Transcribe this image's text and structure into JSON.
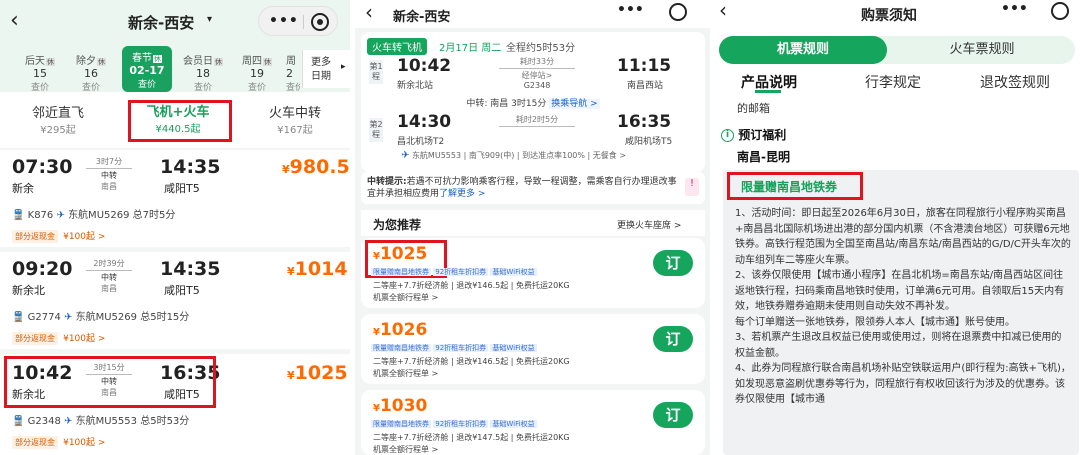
{
  "panel1": {
    "title": "新余-西安",
    "title_caret": "▾",
    "dates": [
      {
        "top": "后天",
        "badge": "休",
        "day": "15",
        "price": "查价"
      },
      {
        "top": "除夕",
        "badge": "休",
        "day": "16",
        "price": "查价"
      },
      {
        "top": "春节",
        "badge": "休",
        "day": "02-17",
        "price": "查价"
      },
      {
        "top": "会员日",
        "badge": "休",
        "day": "18",
        "price": "查价"
      },
      {
        "top": "周四",
        "badge": "休",
        "day": "19",
        "price": "查价"
      },
      {
        "top": "周",
        "badge": "",
        "day": "2",
        "price": "查价"
      }
    ],
    "more_dates": "更多\n日期",
    "modes": [
      {
        "name": "邻近直飞",
        "price": "¥295起"
      },
      {
        "name": "飞机+火车",
        "price": "¥440.5起"
      },
      {
        "name": "火车中转",
        "price": "¥167起"
      }
    ],
    "routes": [
      {
        "dep_time": "07:30",
        "dep_place": "新余",
        "duration": "3时7分",
        "via_label": "中转",
        "via_city": "南昌",
        "arr_time": "14:35",
        "arr_place": "咸阳T5",
        "price_yen": "¥",
        "price": "980.5",
        "train": "K876",
        "flight": "东航MU5269",
        "total": "总7时5分",
        "promo": "部分返现金",
        "promo_amount": "¥100起 >"
      },
      {
        "dep_time": "09:20",
        "dep_place": "新余北",
        "duration": "2时39分",
        "via_label": "中转",
        "via_city": "南昌",
        "arr_time": "14:35",
        "arr_place": "咸阳T5",
        "price_yen": "¥",
        "price": "1014",
        "train": "G2774",
        "flight": "东航MU5269",
        "total": "总5时15分",
        "promo": "部分返现金",
        "promo_amount": "¥100起 >"
      },
      {
        "dep_time": "10:42",
        "dep_place": "新余北",
        "duration": "3时15分",
        "via_label": "中转",
        "via_city": "南昌",
        "arr_time": "16:35",
        "arr_place": "咸阳T5",
        "price_yen": "¥",
        "price": "1025",
        "train": "G2348",
        "flight": "东航MU5553",
        "total": "总5时53分",
        "promo": "部分返现金",
        "promo_amount": "¥100起 >"
      }
    ]
  },
  "panel2": {
    "title": "新余-西安",
    "badge": "火车转飞机",
    "date": "2月17日 周二",
    "total": "全程约5时53分",
    "leg1": {
      "num": "第1程",
      "dep_time": "10:42",
      "dep_place": "新余北站",
      "duration": "耗时33分",
      "via": "经停站>",
      "train": "G2348",
      "arr_time": "11:15",
      "arr_place": "南昌西站"
    },
    "transfer": "中转: 南昌 3时15分",
    "transfer_link": "换乘导航 >",
    "leg2": {
      "num": "第2程",
      "dep_time": "14:30",
      "dep_place": "昌北机场T2",
      "duration": "耗时2时5分",
      "arr_time": "16:35",
      "arr_place": "咸阳机场T5",
      "flight_info": "东航MU5553 | 南飞909(中) | 到达准点率100% | 无餐食 >"
    },
    "notice_label": "中转提示:",
    "notice_text": "若遇不可抗力影响乘客行程，导致一程调整，需乘客自行办理退改事宜并承担相应费用",
    "notice_link": "了解更多 >",
    "rec_title": "为您推荐",
    "rec_link": "更换火车座席 >",
    "offers": [
      {
        "yen": "¥",
        "price": "1025",
        "tags": [
          "限量赠南昌地铁券",
          "92折租车折扣券",
          "基础WiFi权益"
        ],
        "line1a": "二等座+7.7折经济舱",
        "line1b": "退改¥146.5起",
        "line1c": "免费托运20KG",
        "line2": "机票全额行程单 >",
        "book": "订"
      },
      {
        "yen": "¥",
        "price": "1026",
        "tags": [
          "限量赠南昌地铁券",
          "92折租车折扣券",
          "基础WiFi权益"
        ],
        "line1a": "二等座+7.7折经济舱",
        "line1b": "退改¥146.5起",
        "line1c": "免费托运20KG",
        "line2": "机票全额行程单 >",
        "book": "订"
      },
      {
        "yen": "¥",
        "price": "1030",
        "tags": [
          "限量赠南昌地铁券",
          "92折租车折扣券",
          "基础WiFi权益"
        ],
        "line1a": "二等座+7.7折经济舱",
        "line1b": "退改¥147.5起",
        "line1c": "免费托运20KG",
        "line2": "机票全额行程单 >",
        "book": "订"
      }
    ]
  },
  "panel3": {
    "title": "购票须知",
    "tabs": [
      "机票规则",
      "火车票规则"
    ],
    "subtabs": [
      "产品说明",
      "行李规定",
      "退改签规则"
    ],
    "mailbox": "的邮箱",
    "benefit_title": "预订福利",
    "route": "南昌-昆明",
    "promo": "限量赠南昌地铁券",
    "rules": "1、活动时间：即日起至2026年6月30日，旅客在同程旅行小程序购买南昌+南昌昌北国际机场进出港的部分国内机票（不含港澳台地区）可获赠6元地铁券。高铁行程范围为全国至南昌站/南昌东站/南昌西站的G/D/C开头车次的动车组列车二等座火车票。\n2、该券仅限使用【城市通小程序】在昌北机场=南昌东站/南昌西站区间往返地铁行程，扫码乘南昌地铁时使用，订单满6元可用。自领取后15天内有效，地铁券赠券逾期未使用则自动失效不再补发。\n每个订单赠送一张地铁券，限领券人本人【城市通】账号使用。\n3、若机票产生退改且权益已使用或使用过，则将在退票费中扣减已使用的权益金额。\n4、此券为同程旅行联合南昌机场补贴空铁联运用户(即行程为:高铁+飞机)，如发现恶意盗刷优惠券等行为，同程旅行有权收回该行为涉及的优惠券。该券仅限使用【城市通"
  },
  "colors": {
    "green": "#14a05a",
    "orange": "#ff6a00",
    "red": "#e0141e",
    "blue": "#1b62c8"
  }
}
